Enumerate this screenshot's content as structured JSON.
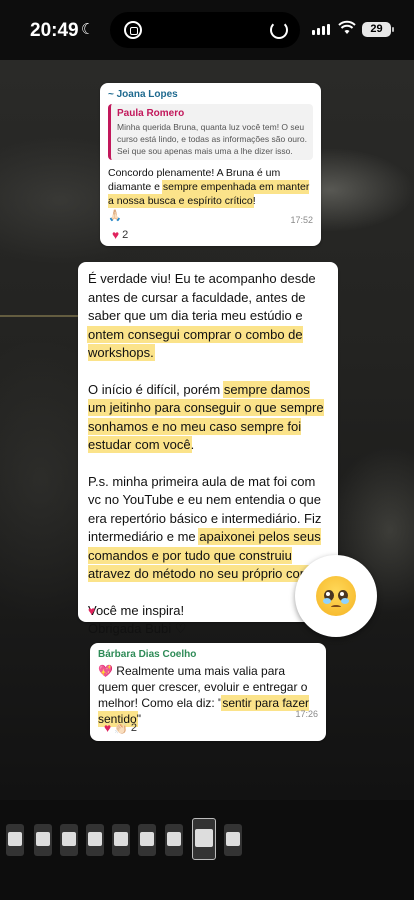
{
  "status_bar": {
    "time": "20:49",
    "battery": "29"
  },
  "messages": [
    {
      "sender": "~ Joana Lopes",
      "quote": {
        "name": "Paula Romero",
        "text": "Minha querida Bruna, quanta luz você tem! O seu curso está lindo, e todas as informações são ouro. Sei que sou apenas mais uma a lhe dizer isso. As..."
      },
      "body_parts": [
        "Concordo plenamente! A Bruna é um diamante e ",
        "sempre empenhada em manter a nossa busca e espírito crítico",
        "!"
      ],
      "emoji": "🙏🏻",
      "time": "17:52",
      "reactions": {
        "icon": "heart",
        "count": "2"
      }
    },
    {
      "paragraphs": [
        {
          "plain": "É verdade viu! Eu te acompanho desde antes de cursar a faculdade, antes de saber que um dia teria meu estúdio e ",
          "highlight": "ontem consegui comprar o combo de workshops.",
          "after": ""
        },
        {
          "plain": "O início é difícil, porém ",
          "highlight": "sempre damos um jeitinho para conseguir o que sempre sonhamos e no meu caso sempre foi estudar com você",
          "after": "."
        },
        {
          "plain": "P.s. minha primeira aula de mat foi com vc no YouTube e eu nem entendia o que era repertório básico e intermediário. Fiz intermediário e me ",
          "highlight": "apaixonei pelos seus comandos e por tudo que construiu atravez do método no seu próprio corpo.",
          "after": ""
        },
        {
          "plain": "Você me inspira! Obrigada Bubi ♡",
          "highlight": "",
          "after": ""
        }
      ],
      "reactions": {
        "icon": "heart"
      }
    },
    {
      "sender": "Bárbara Dias Coelho",
      "body_prefix": "Realmente uma mais valia para quem quer crescer, evoluir e entregar o melhor! Como ela diz: \"",
      "body_highlight": "sentir para fazer sentido",
      "body_suffix": "\"",
      "time": "17:26",
      "reactions": {
        "icons": "heart, clap",
        "count": "2"
      }
    }
  ],
  "reaction_emoji": "pleading-face",
  "thumbnails": {
    "count": 9,
    "active_index": 7
  },
  "colors": {
    "highlight": "#fbe38a",
    "sender_joana": "#1f6a8f",
    "sender_paula": "#c2185b",
    "sender_barbara": "#2e8b57"
  }
}
